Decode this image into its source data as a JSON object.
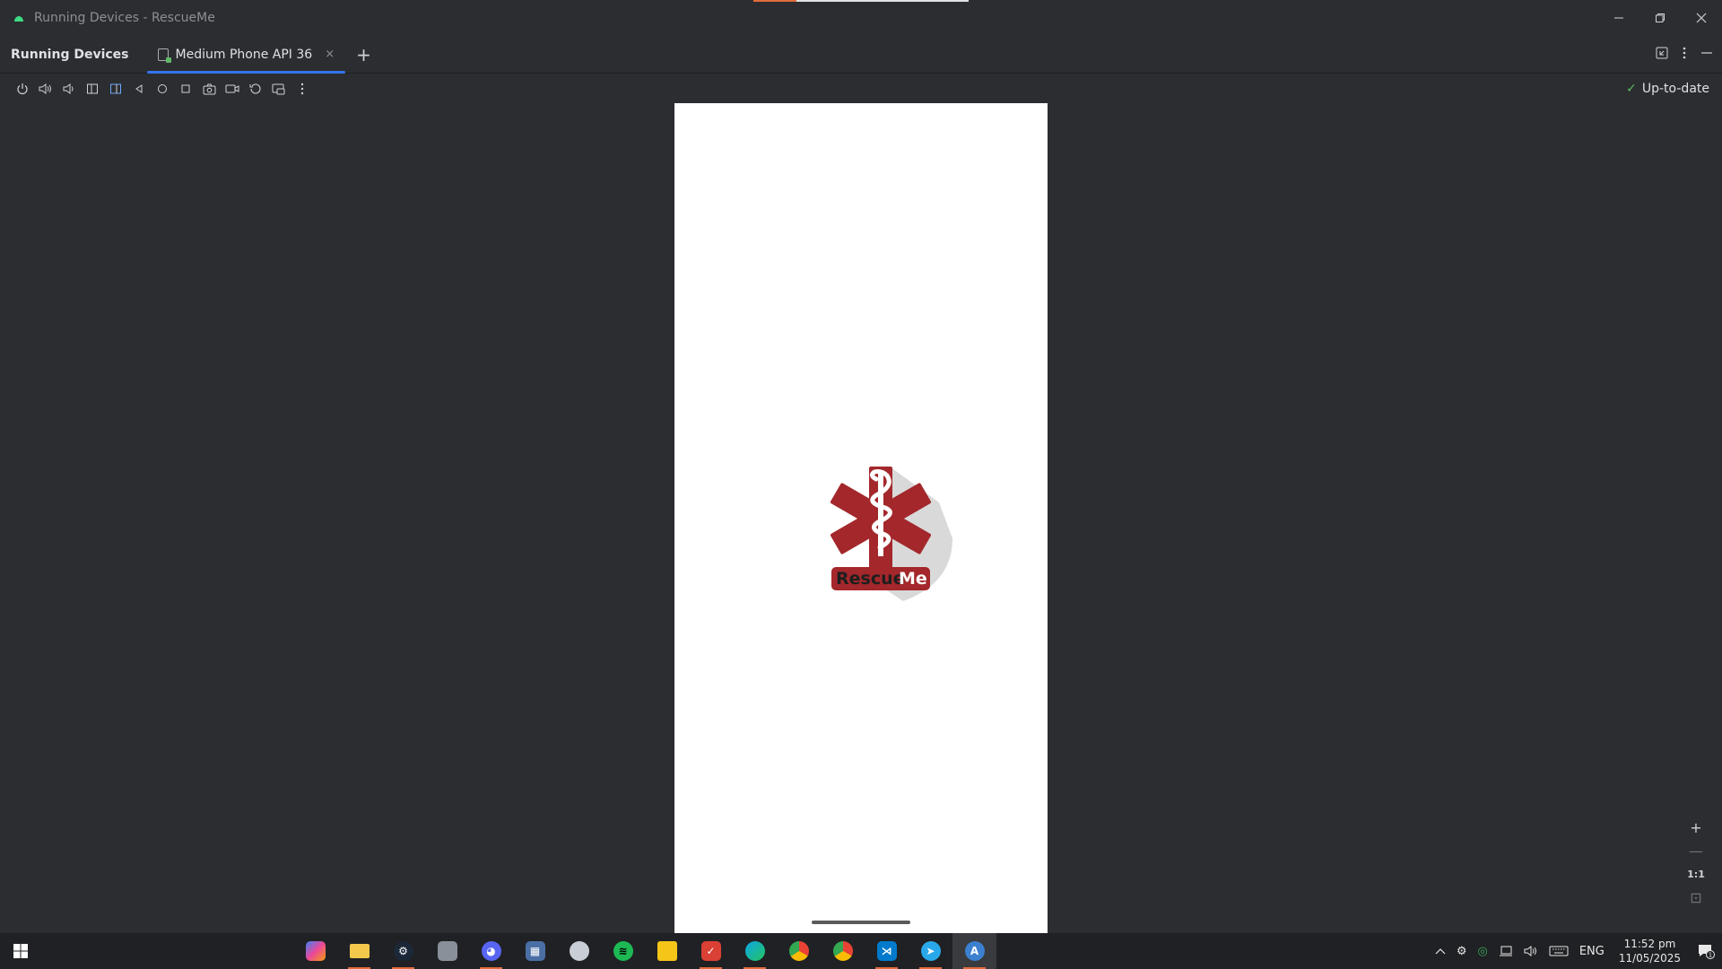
{
  "window": {
    "title": "Running Devices - RescueMe"
  },
  "tabbar": {
    "tool_title": "Running Devices",
    "active_tab": "Medium Phone API 36",
    "close_glyph": "×",
    "add_glyph": "+"
  },
  "toolbar": {
    "icons": [
      "power-icon",
      "volume-up-icon",
      "volume-down-icon",
      "rotate-left-icon",
      "rotate-right-icon",
      "back-icon",
      "home-icon",
      "overview-icon",
      "screenshot-icon",
      "screen-record-icon",
      "reset-icon",
      "snapshot-icon",
      "more-icon"
    ],
    "status": "Up-to-date"
  },
  "device": {
    "app_name_part1": "Rescue",
    "app_name_part2": "Me",
    "brand_color": "#a3272b"
  },
  "zoom": {
    "in": "+",
    "out": "—",
    "actual": "1:1",
    "fit": "⊡"
  },
  "taskbar": {
    "apps": [
      "copilot",
      "file-explorer",
      "steam",
      "file-manager",
      "discord",
      "calculator",
      "security",
      "spotify",
      "sticky-notes",
      "todoist",
      "edge",
      "chrome-profile",
      "chrome",
      "vscode",
      "telegram",
      "android-studio"
    ],
    "language": "ENG",
    "time": "11:52 pm",
    "date": "11/05/2025",
    "notification_count": "1"
  }
}
